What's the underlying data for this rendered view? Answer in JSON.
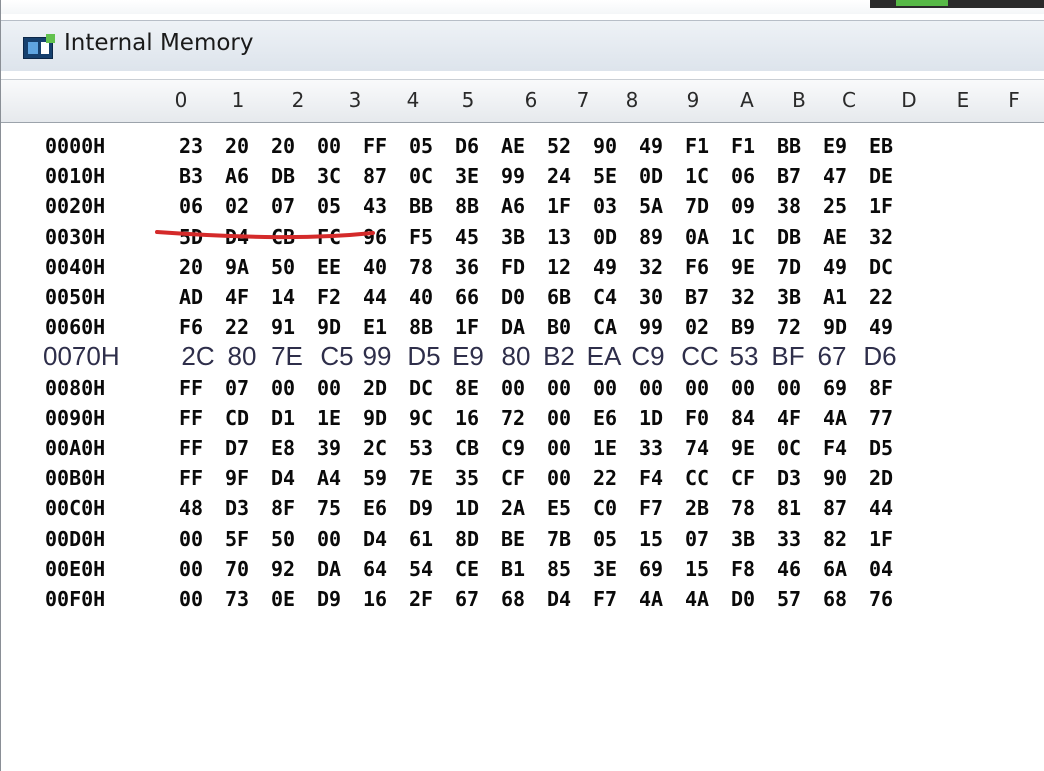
{
  "window": {
    "title": "Internal Memory",
    "icon": "window-app-icon"
  },
  "columns": [
    "0",
    "1",
    "2",
    "3",
    "4",
    "5",
    "6",
    "7",
    "8",
    "9",
    "A",
    "B",
    "C",
    "D",
    "E",
    "F"
  ],
  "rows": [
    {
      "addr": "0000H",
      "bytes": [
        "23",
        "20",
        "20",
        "00",
        "FF",
        "05",
        "D6",
        "AE",
        "52",
        "90",
        "49",
        "F1",
        "F1",
        "BB",
        "E9",
        "EB"
      ]
    },
    {
      "addr": "0010H",
      "bytes": [
        "B3",
        "A6",
        "DB",
        "3C",
        "87",
        "0C",
        "3E",
        "99",
        "24",
        "5E",
        "0D",
        "1C",
        "06",
        "B7",
        "47",
        "DE"
      ]
    },
    {
      "addr": "0020H",
      "bytes": [
        "06",
        "02",
        "07",
        "05",
        "43",
        "BB",
        "8B",
        "A6",
        "1F",
        "03",
        "5A",
        "7D",
        "09",
        "38",
        "25",
        "1F"
      ]
    },
    {
      "addr": "0030H",
      "bytes": [
        "5D",
        "D4",
        "CB",
        "FC",
        "96",
        "F5",
        "45",
        "3B",
        "13",
        "0D",
        "89",
        "0A",
        "1C",
        "DB",
        "AE",
        "32"
      ]
    },
    {
      "addr": "0040H",
      "bytes": [
        "20",
        "9A",
        "50",
        "EE",
        "40",
        "78",
        "36",
        "FD",
        "12",
        "49",
        "32",
        "F6",
        "9E",
        "7D",
        "49",
        "DC"
      ]
    },
    {
      "addr": "0050H",
      "bytes": [
        "AD",
        "4F",
        "14",
        "F2",
        "44",
        "40",
        "66",
        "D0",
        "6B",
        "C4",
        "30",
        "B7",
        "32",
        "3B",
        "A1",
        "22"
      ]
    },
    {
      "addr": "0060H",
      "bytes": [
        "F6",
        "22",
        "91",
        "9D",
        "E1",
        "8B",
        "1F",
        "DA",
        "B0",
        "CA",
        "99",
        "02",
        "B9",
        "72",
        "9D",
        "49"
      ]
    },
    {
      "addr": "0070H",
      "bytes": [
        "2C",
        "80",
        "7E",
        "C5",
        "99",
        "D5",
        "E9",
        "80",
        "B2",
        "EA",
        "C9",
        "CC",
        "53",
        "BF",
        "67",
        "D6"
      ]
    },
    {
      "addr": "0080H",
      "bytes": [
        "FF",
        "07",
        "00",
        "00",
        "2D",
        "DC",
        "8E",
        "00",
        "00",
        "00",
        "00",
        "00",
        "00",
        "00",
        "69",
        "8F"
      ]
    },
    {
      "addr": "0090H",
      "bytes": [
        "FF",
        "CD",
        "D1",
        "1E",
        "9D",
        "9C",
        "16",
        "72",
        "00",
        "E6",
        "1D",
        "F0",
        "84",
        "4F",
        "4A",
        "77"
      ]
    },
    {
      "addr": "00A0H",
      "bytes": [
        "FF",
        "D7",
        "E8",
        "39",
        "2C",
        "53",
        "CB",
        "C9",
        "00",
        "1E",
        "33",
        "74",
        "9E",
        "0C",
        "F4",
        "D5"
      ]
    },
    {
      "addr": "00B0H",
      "bytes": [
        "FF",
        "9F",
        "D4",
        "A4",
        "59",
        "7E",
        "35",
        "CF",
        "00",
        "22",
        "F4",
        "CC",
        "CF",
        "D3",
        "90",
        "2D"
      ]
    },
    {
      "addr": "00C0H",
      "bytes": [
        "48",
        "D3",
        "8F",
        "75",
        "E6",
        "D9",
        "1D",
        "2A",
        "E5",
        "C0",
        "F7",
        "2B",
        "78",
        "81",
        "87",
        "44"
      ]
    },
    {
      "addr": "00D0H",
      "bytes": [
        "00",
        "5F",
        "50",
        "00",
        "D4",
        "61",
        "8D",
        "BE",
        "7B",
        "05",
        "15",
        "07",
        "3B",
        "33",
        "82",
        "1F"
      ]
    },
    {
      "addr": "00E0H",
      "bytes": [
        "00",
        "70",
        "92",
        "DA",
        "64",
        "54",
        "CE",
        "B1",
        "85",
        "3E",
        "69",
        "15",
        "F8",
        "46",
        "6A",
        "04"
      ]
    },
    {
      "addr": "00F0H",
      "bytes": [
        "00",
        "73",
        "0E",
        "D9",
        "16",
        "2F",
        "67",
        "68",
        "D4",
        "F7",
        "4A",
        "4A",
        "D0",
        "57",
        "68",
        "76"
      ]
    }
  ],
  "styles": {
    "underline_color": "#d42a2a",
    "text_color": "#0a0a0a"
  }
}
